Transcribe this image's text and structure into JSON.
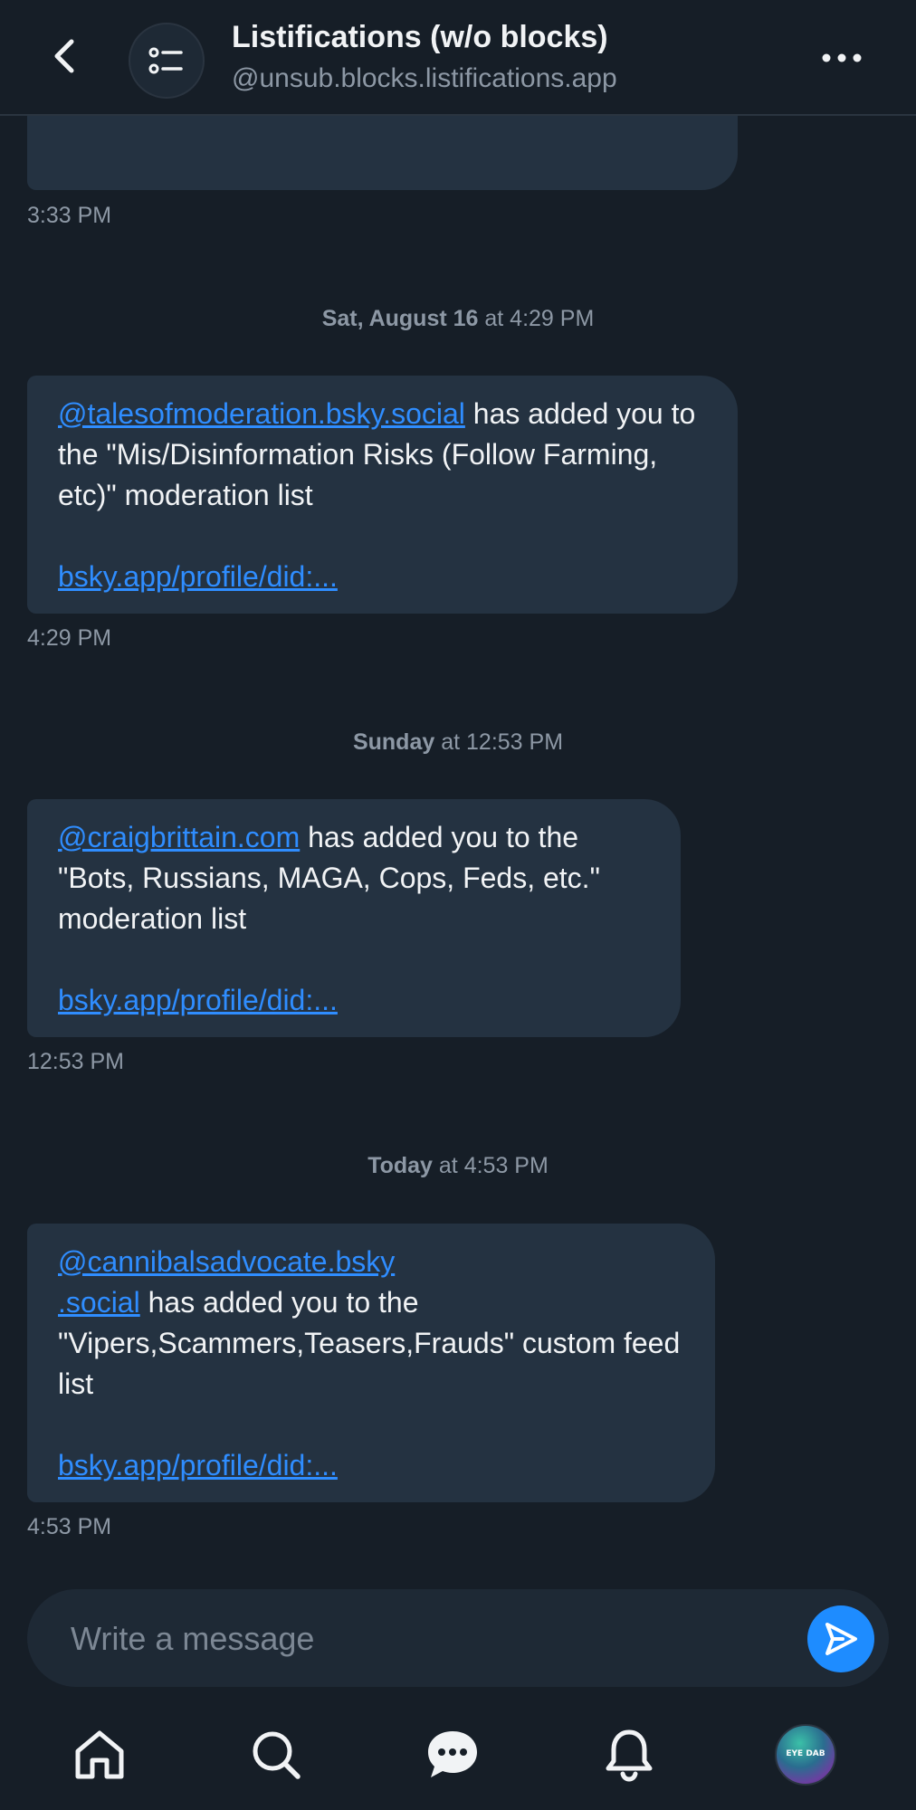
{
  "header": {
    "title": "Listifications (w/o blocks)",
    "handle": "@unsub.blocks.listifications.app"
  },
  "thread": {
    "first_time": "3:33 PM",
    "groups": [
      {
        "day_bold": "Sat, August 16",
        "day_rest": " at 4:29 PM",
        "message": {
          "mention": "@talesofmoderation.bsky.social",
          "text": " has added you to the \"Mis/Disinformation Risks (Follow Farming, etc)\" moderation list",
          "url": "bsky.app/profile/did:..."
        },
        "time": "4:29 PM"
      },
      {
        "day_bold": "Sunday",
        "day_rest": " at 12:53 PM",
        "message": {
          "mention": "@craigbrittain.com",
          "text": " has added you to the \"Bots, Russians, MAGA, Cops, Feds, etc.\" moderation list",
          "url": "bsky.app/profile/did:..."
        },
        "time": "12:53 PM"
      },
      {
        "day_bold": "Today",
        "day_rest": " at 4:53 PM",
        "message": {
          "mention_line1": "@cannibalsadvocate.bsky",
          "mention_line2": ".social",
          "text": " has added you to the \"Vipers,Scammers,Teasers,Frauds\" custom feed list",
          "url": "bsky.app/profile/did:..."
        },
        "time": "4:53 PM"
      }
    ]
  },
  "composer": {
    "placeholder": "Write a message"
  },
  "tabbar": {
    "profile_avatar_text": "EYE DAB"
  },
  "colors": {
    "background": "#161e27",
    "bubble": "#243241",
    "link": "#2f8dff",
    "accent": "#1e8cff",
    "muted": "#8d98a5"
  },
  "icons": [
    "back-chevron-icon",
    "list-icon",
    "more-horizontal-icon",
    "send-icon",
    "home-icon",
    "search-icon",
    "chat-icon",
    "bell-icon"
  ]
}
